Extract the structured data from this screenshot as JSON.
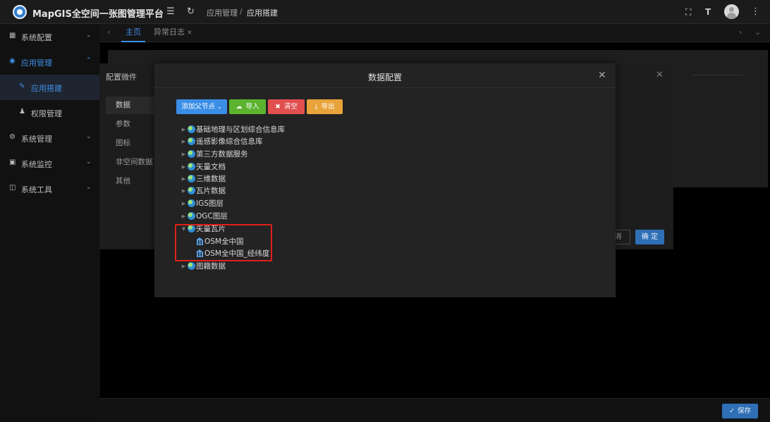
{
  "header": {
    "app_title": "MapGIS全空间一张图管理平台",
    "breadcrumb": [
      "应用管理",
      "应用搭建"
    ],
    "breadcrumb_separator": "/",
    "icons": [
      "menu-fold-icon",
      "refresh-icon",
      "fullscreen-icon",
      "font-size-icon",
      "avatar",
      "more-icon"
    ]
  },
  "sidebar": {
    "items": [
      {
        "label": "系统配置",
        "icon": "grid-icon",
        "expanded": false
      },
      {
        "label": "应用管理",
        "icon": "app-icon",
        "expanded": true
      },
      {
        "label": "应用搭建",
        "icon": "edit-icon",
        "sub": true,
        "selected": true
      },
      {
        "label": "权限管理",
        "icon": "user-lock-icon",
        "sub": true
      },
      {
        "label": "系统管理",
        "icon": "gear-icon",
        "expanded": false
      },
      {
        "label": "系统监控",
        "icon": "monitor-icon",
        "expanded": false
      },
      {
        "label": "系统工具",
        "icon": "toolbox-icon",
        "expanded": false
      }
    ]
  },
  "tabs": {
    "items": [
      {
        "label": "主页",
        "active": true
      },
      {
        "label": "异常日志",
        "closable": true
      }
    ]
  },
  "config_dialog": {
    "title": "配置微件",
    "menu": [
      "数据",
      "参数",
      "图标",
      "非空间数据",
      "其他"
    ],
    "active_menu": "数据",
    "cancel_label": "消",
    "ok_label": "确 定"
  },
  "data_dialog": {
    "title": "数据配置",
    "buttons": {
      "add_label": "添加父节点",
      "import_label": "导入",
      "clear_label": "清空",
      "export_label": "导出"
    },
    "tree": [
      {
        "label": "基础地理与区划综合信息库",
        "expanded": false
      },
      {
        "label": "遥感影像综合信息库",
        "expanded": false
      },
      {
        "label": "第三方数据服务",
        "expanded": false
      },
      {
        "label": "矢量文档",
        "expanded": false
      },
      {
        "label": "三维数据",
        "expanded": false
      },
      {
        "label": "瓦片数据",
        "expanded": false
      },
      {
        "label": "IGS图层",
        "expanded": false
      },
      {
        "label": "OGC图层",
        "expanded": false
      },
      {
        "label": "矢量瓦片",
        "expanded": true,
        "children": [
          {
            "label": "OSM全中国"
          },
          {
            "label": "OSM全中国_经纬度"
          }
        ]
      },
      {
        "label": "图籍数据",
        "expanded": false
      }
    ]
  },
  "footer": {
    "save_label": "保存"
  },
  "colors": {
    "accent": "#3f8fe6",
    "import_green": "#5cb32f",
    "clear_red": "#e14f4f",
    "export_orange": "#e8a33a",
    "highlight_red": "#e0201a"
  }
}
